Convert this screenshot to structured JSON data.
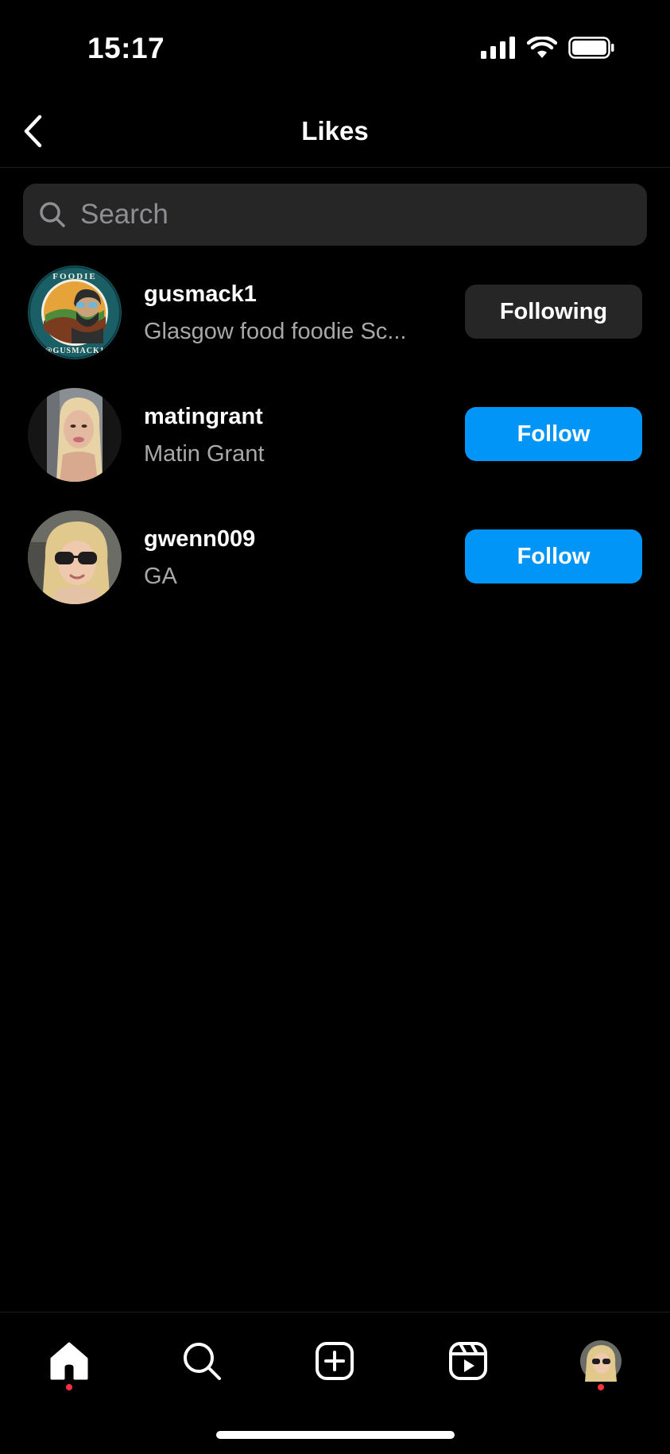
{
  "status_bar": {
    "time": "15:17",
    "icons": [
      "signal-icon",
      "wifi-icon",
      "battery-icon"
    ]
  },
  "header": {
    "title": "Likes",
    "back_icon": "chevron-left-icon"
  },
  "search": {
    "placeholder": "Search",
    "value": "",
    "icon": "search-icon"
  },
  "likes": [
    {
      "username": "gusmack1",
      "full_name": "Glasgow food foodie Sc...",
      "button_label": "Following",
      "button_state": "following",
      "avatar": "foodie-gusmack-logo"
    },
    {
      "username": "matingrant",
      "full_name": "Matin Grant",
      "button_label": "Follow",
      "button_state": "follow",
      "avatar": "profile-photo"
    },
    {
      "username": "gwenn009",
      "full_name": "GA",
      "button_label": "Follow",
      "button_state": "follow",
      "avatar": "profile-photo"
    }
  ],
  "tab_bar": {
    "items": [
      {
        "name": "home",
        "icon": "home-icon",
        "active": true,
        "badge": true
      },
      {
        "name": "search",
        "icon": "search-icon",
        "active": false,
        "badge": false
      },
      {
        "name": "create",
        "icon": "plus-square-icon",
        "active": false,
        "badge": false
      },
      {
        "name": "reels",
        "icon": "reels-icon",
        "active": false,
        "badge": false
      },
      {
        "name": "profile",
        "icon": "avatar",
        "active": false,
        "badge": true
      }
    ]
  },
  "colors": {
    "background": "#000000",
    "follow_button": "#0095f6",
    "following_button": "#262626",
    "search_background": "#262626",
    "secondary_text": "#a8a8a8",
    "badge": "#ff3040"
  }
}
